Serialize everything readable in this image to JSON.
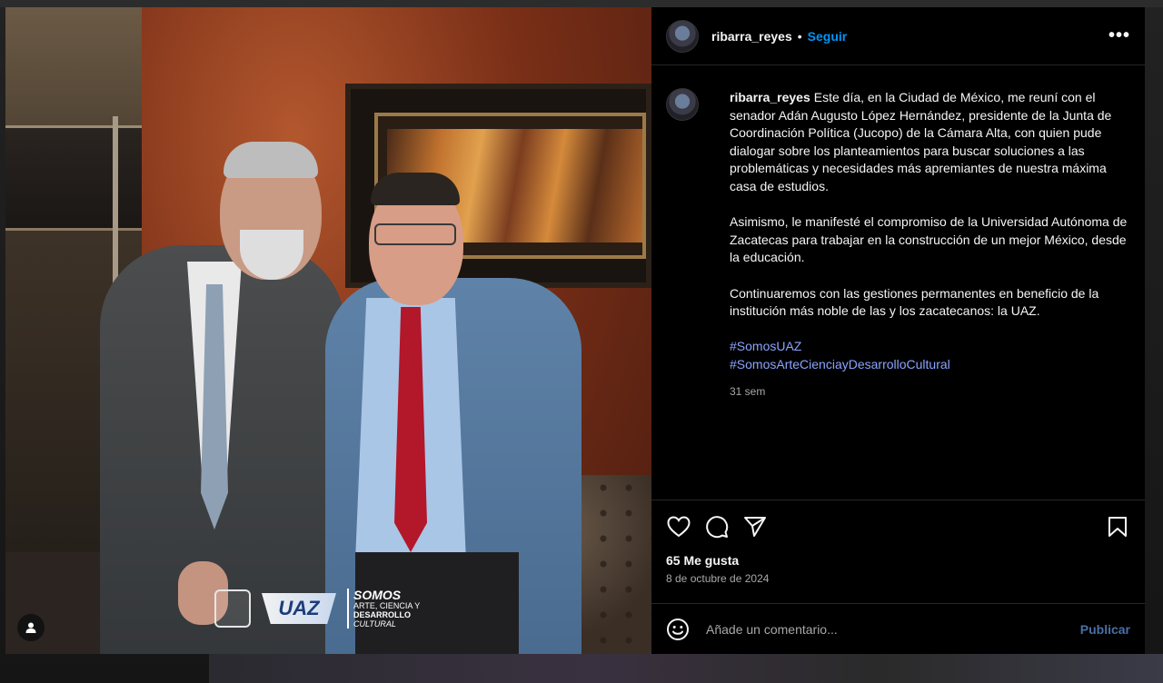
{
  "post": {
    "username": "ribarra_reyes",
    "separator": "•",
    "follow_label": "Seguir",
    "more_label": "•••",
    "caption": {
      "username": "ribarra_reyes",
      "paragraph1": "Este día, en la Ciudad de México, me reuní con el senador Adán Augusto López Hernández, presidente de la Junta de Coordinación Política (Jucopo) de la Cámara Alta, con quien pude dialogar sobre los planteamientos para buscar soluciones a las problemáticas y necesidades más apremiantes de nuestra máxima casa de estudios.",
      "paragraph2": "Asimismo, le manifesté el compromiso de la Universidad Autónoma de Zacatecas para trabajar en la construcción de un mejor México, desde la educación.",
      "paragraph3": "Continuaremos con las gestiones permanentes en beneficio de la institución más noble de las y los zacatecanos: la UAZ.",
      "hashtags": [
        "#SomosUAZ",
        "#SomosArteCienciayDesarrolloCultural"
      ],
      "time": "31 sem"
    },
    "likes": "65 Me gusta",
    "date": "8 de octubre de 2024",
    "comment_placeholder": "Añade un comentario...",
    "publish_label": "Publicar"
  },
  "photo_overlay": {
    "logo_uaz": "UAZ",
    "somos_big": "SOMOS",
    "somos_line1": "ARTE, CIENCIA Y",
    "somos_line2": "DESARROLLO",
    "somos_line3": "CULTURAL"
  },
  "icons": {
    "like": "heart-icon",
    "comment": "comment-icon",
    "share": "share-icon",
    "save": "bookmark-icon",
    "emoji": "emoji-icon",
    "person": "person-icon",
    "more": "more-icon"
  },
  "colors": {
    "panel_bg": "#000000",
    "follow": "#0095f6",
    "hashtag": "#8aa4ff",
    "publish": "#4a6fa5",
    "muted": "#a8a8a8"
  }
}
